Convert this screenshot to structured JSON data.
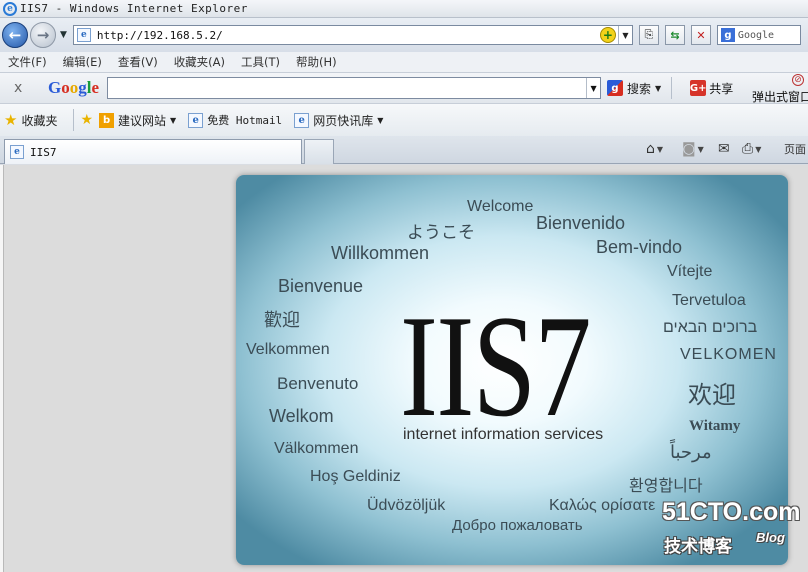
{
  "window": {
    "title": "IIS7 - Windows Internet Explorer"
  },
  "address_bar": {
    "url": "http://192.168.5.2/",
    "search_engine_label": "Google"
  },
  "menu": [
    "文件(F)",
    "编辑(E)",
    "查看(V)",
    "收藏夹(A)",
    "工具(T)",
    "帮助(H)"
  ],
  "google_toolbar": {
    "close_label": "x",
    "logo": [
      "G",
      "o",
      "o",
      "g",
      "l",
      "e"
    ],
    "search_label": "搜索",
    "share_label": "共享",
    "popup_label": "弹出式窗口"
  },
  "favorites_bar": {
    "favorites_label": "收藏夹",
    "items": [
      {
        "label": "建议网站",
        "icon": "bing-icon"
      },
      {
        "label": "免费 Hotmail",
        "icon": "ie-page-icon"
      },
      {
        "label": "网页快讯库",
        "icon": "ie-page-icon"
      }
    ]
  },
  "tab": {
    "label": "IIS7"
  },
  "command_bar": {
    "page_label": "页面"
  },
  "iis_page": {
    "logo_text": "IIS7",
    "subtitle": "internet information services",
    "welcome_words": [
      "Welcome",
      "ようこそ",
      "Bienvenido",
      "Willkommen",
      "Bem-vindo",
      "Vítejte",
      "Bienvenue",
      "Tervetuloa",
      "歡迎",
      "ברוכים הבאים",
      "Velkommen",
      "VELKOMEN",
      "Benvenuto",
      "欢迎",
      "Welkom",
      "Witamy",
      "Välkommen",
      "مرحباً",
      "Hoş Geldiniz",
      "환영합니다",
      "Üdvözöljük",
      "Καλώς ορίσατε",
      "Добро пожаловать"
    ]
  },
  "watermark": {
    "site": "51CTO.com",
    "sub": "技术博客",
    "blog": "Blog"
  },
  "colors": {
    "ie_blue": "#2a7ad6",
    "iis_bg_outer": "#4e8ba3",
    "iis_bg_inner": "#ffffff"
  }
}
